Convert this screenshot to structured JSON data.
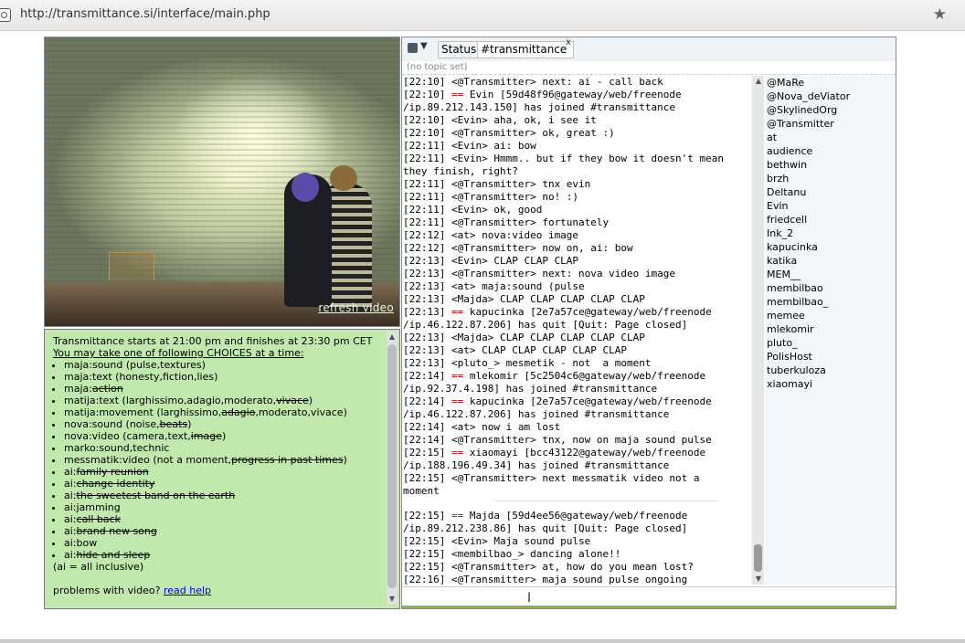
{
  "browser": {
    "url": "http://transmittance.si/interface/main.php"
  },
  "video": {
    "refresh_label": "refresh video"
  },
  "info": {
    "line1": "Transmittance starts at 21:00 pm and finishes at 23:30 pm CET",
    "line2": "You may take one of following CHOICES at a time:",
    "choices": [
      {
        "a": "maja:sound (pulse,textures)",
        "s": "",
        "b": ""
      },
      {
        "a": "maja:text (honesty,fiction,lies)",
        "s": "",
        "b": ""
      },
      {
        "a": "maja:",
        "s": "action",
        "b": ""
      },
      {
        "a": "matija:text (larghissimo,adagio,moderato,",
        "s": "vivace",
        "b": ")"
      },
      {
        "a": "matija:movement (larghissimo,",
        "s": "adagio",
        "b": ",moderato,vivace)"
      },
      {
        "a": "nova:sound (noise,",
        "s": "beats",
        "b": ")"
      },
      {
        "a": "nova:video (camera,text,",
        "s": "image",
        "b": ")"
      },
      {
        "a": "marko:sound,technic",
        "s": "",
        "b": ""
      },
      {
        "a": "messmatik:video (not a moment,",
        "s": "progress in past times",
        "b": ")"
      },
      {
        "a": "ai:",
        "s": "family reunion",
        "b": ""
      },
      {
        "a": "ai:",
        "s": "change identity",
        "b": ""
      },
      {
        "a": "ai:",
        "s": "the sweetest band on the earth",
        "b": ""
      },
      {
        "a": "ai:jamming",
        "s": "",
        "b": ""
      },
      {
        "a": "ai:",
        "s": "call back",
        "b": ""
      },
      {
        "a": "ai:",
        "s": "brand new song",
        "b": ""
      },
      {
        "a": "ai:bow",
        "s": "",
        "b": ""
      },
      {
        "a": "ai:",
        "s": "hide and sleep",
        "b": ""
      }
    ],
    "note": "(ai = all inclusive)",
    "problems_text": "problems with video? ",
    "help_link": "read help"
  },
  "chat": {
    "tab_status": "Status",
    "tab_channel": "#transmittance",
    "tab_close": "x",
    "topic": "(no topic set)",
    "log": [
      {
        "t": "[22:10] <@Transmitter> next: ai - call back"
      },
      {
        "t": "[22:10] ",
        "e": "==",
        "r": " Evin [59d48f96@gateway/web/freenode"
      },
      {
        "t": "/ip.89.212.143.150] has joined #transmittance"
      },
      {
        "t": "[22:10] <Evin> aha, ok, i see it"
      },
      {
        "t": "[22:10] <@Transmitter> ok, great :)"
      },
      {
        "t": "[22:11] <Evin> ai: bow"
      },
      {
        "t": "[22:11] <Evin> Hmmm.. but if they bow it doesn't mean"
      },
      {
        "t": "they finish, right?"
      },
      {
        "t": "[22:11] <@Transmitter> tnx evin"
      },
      {
        "t": "[22:11] <@Transmitter> no! :)"
      },
      {
        "t": "[22:11] <Evin> ok, good"
      },
      {
        "t": "[22:11] <@Transmitter> fortunately"
      },
      {
        "t": "[22:12] <at> nova:video image"
      },
      {
        "t": "[22:12] <@Transmitter> now on, ai: bow"
      },
      {
        "t": "[22:13] <Evin> CLAP CLAP CLAP"
      },
      {
        "t": "[22:13] <@Transmitter> next: nova video image"
      },
      {
        "t": "[22:13] <at> maja:sound (pulse"
      },
      {
        "t": "[22:13] <Majda> CLAP CLAP CLAP CLAP CLAP"
      },
      {
        "t": "[22:13] ",
        "e": "==",
        "r": " kapucinka [2e7a57ce@gateway/web/freenode"
      },
      {
        "t": "/ip.46.122.87.206] has quit [Quit: Page closed]"
      },
      {
        "t": "[22:13] <Majda> CLAP CLAP CLAP CLAP CLAP"
      },
      {
        "t": "[22:13] <at> CLAP CLAP CLAP CLAP CLAP"
      },
      {
        "t": "[22:13] <pluto_> mesmetik - not  a moment"
      },
      {
        "t": "[22:14] ",
        "e": "==",
        "r": " mlekomir [5c2504c6@gateway/web/freenode"
      },
      {
        "t": "/ip.92.37.4.198] has joined #transmittance"
      },
      {
        "t": "[22:14] ",
        "e": "==",
        "r": " kapucinka [2e7a57ce@gateway/web/freenode"
      },
      {
        "t": "/ip.46.122.87.206] has joined #transmittance"
      },
      {
        "t": "[22:14] <at> now i am lost"
      },
      {
        "t": "[22:14] <@Transmitter> tnx, now on maja sound pulse"
      },
      {
        "t": "[22:15] ",
        "e": "==",
        "r": " xiaomayi [bcc43122@gateway/web/freenode"
      },
      {
        "t": "/ip.188.196.49.34] has joined #transmittance"
      },
      {
        "t": "[22:15] <@Transmitter> next messmatik video not a"
      },
      {
        "t": "moment"
      }
    ],
    "log2": [
      {
        "t": "[22:15] ",
        "e": "==",
        "r": " Majda [59d4ee56@gateway/web/freenode"
      },
      {
        "t": "/ip.89.212.238.86] has quit [Quit: Page closed]"
      },
      {
        "t": "[22:15] <Evin> Maja sound pulse"
      },
      {
        "t": "[22:15] <membilbao_> dancing alone!!"
      },
      {
        "t": "[22:15] <@Transmitter> at, how do you mean lost?"
      },
      {
        "t": "[22:16] <@Transmitter> maja sound pulse ongoing"
      }
    ],
    "nicks": [
      "@MaRe",
      "@Nova_deViator",
      "@SkylinedOrg",
      "@Transmitter",
      "at",
      "audience",
      "bethwin",
      "brzh",
      "Deltanu",
      "Evin",
      "friedcell",
      "Ink_2",
      "kapucinka",
      "katika",
      "MEM__",
      "membilbao",
      "membilbao_",
      "memee",
      "mlekomir",
      "pluto_",
      "PolisHost",
      "tuberkuloza",
      "xiaomayi"
    ],
    "input_value": ""
  }
}
